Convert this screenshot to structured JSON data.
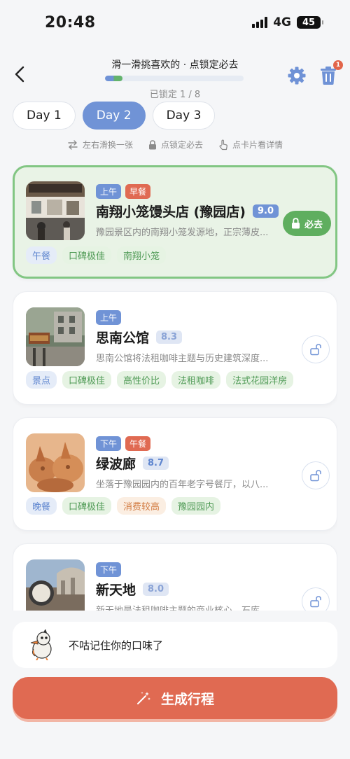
{
  "status_bar": {
    "time": "20:48",
    "network": "4G",
    "battery": "45"
  },
  "header": {
    "title": "滑一滑挑喜欢的 · 点锁定必去",
    "progress_fraction": 0.125,
    "locked_text": "已锁定 1 / 8",
    "trash_badge": "1"
  },
  "day_tabs": [
    {
      "label": "Day 1",
      "active": false
    },
    {
      "label": "Day 2",
      "active": true
    },
    {
      "label": "Day 3",
      "active": false
    }
  ],
  "hints": [
    {
      "icon": "swap-icon",
      "text": "左右滑换一张"
    },
    {
      "icon": "lock-icon",
      "text": "点锁定必去"
    },
    {
      "icon": "tap-icon",
      "text": "点卡片看详情"
    }
  ],
  "cards": [
    {
      "time": "上午",
      "meal": "早餐",
      "title": "南翔小笼馒头店 (豫园店)",
      "score": "9.0",
      "desc": "豫园景区内的南翔小笼发源地，正宗薄皮...",
      "chips": [
        "午餐",
        "口碑极佳",
        "南翔小笼"
      ],
      "locked": true,
      "lock_label": "必去"
    },
    {
      "time": "上午",
      "title": "思南公馆",
      "score": "8.3",
      "desc": "思南公馆将法租咖啡主题与历史建筑深度...",
      "chips": [
        "景点",
        "口碑极佳",
        "高性价比",
        "法租咖啡",
        "法式花园洋房"
      ],
      "locked": false
    },
    {
      "time": "下午",
      "meal": "午餐",
      "title": "绿波廊",
      "score": "8.7",
      "desc": "坐落于豫园园内的百年老字号餐厅，以八...",
      "chips": [
        "晚餐",
        "口碑极佳",
        "消费较高",
        "豫园园内"
      ],
      "locked": false
    },
    {
      "time": "下午",
      "title": "新天地",
      "score": "8.0",
      "desc": "新天地是法租咖啡主题的商业核心、石库...",
      "chips": [],
      "locked": false
    }
  ],
  "mascot": {
    "text": "不咕记住你的口味了"
  },
  "generate_button": {
    "label": "生成行程"
  },
  "colors": {
    "accent_blue": "#7093d6",
    "accent_orange": "#e06a52",
    "lock_green": "#5fae5f"
  }
}
